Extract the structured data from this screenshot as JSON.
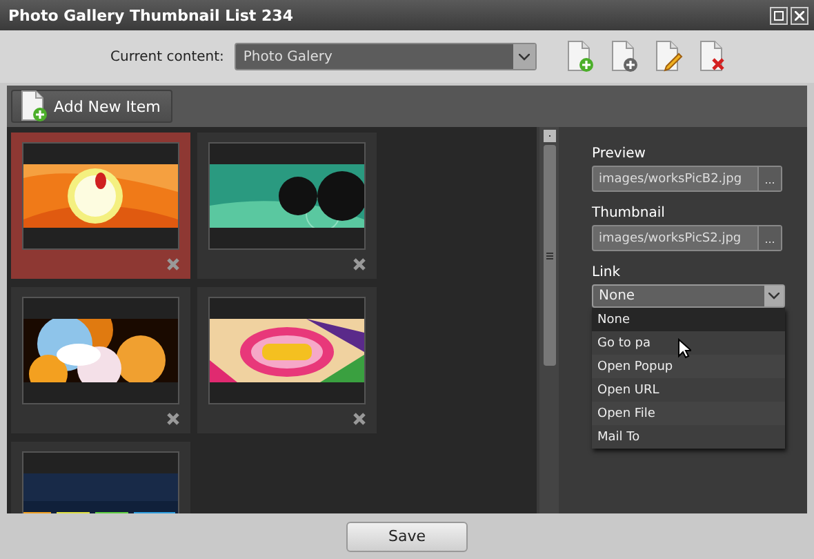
{
  "window": {
    "title": "Photo Gallery Thumbnail List 234"
  },
  "toolbar": {
    "label": "Current content:",
    "select": {
      "value": "Photo Galery"
    }
  },
  "add_button": {
    "label": "Add New Item"
  },
  "items": [
    {
      "kind": "picture",
      "selected": true
    },
    {
      "kind": "picture",
      "selected": false
    },
    {
      "kind": "picture",
      "selected": false
    },
    {
      "kind": "picture",
      "selected": false
    },
    {
      "kind": "picture",
      "selected": false
    }
  ],
  "fields": [
    {
      "label": "Preview",
      "value": "images/worksPicB2.jpg",
      "button": "..."
    },
    {
      "label": "Thumbnail",
      "value": "images/worksPicS2.jpg",
      "button": "..."
    }
  ],
  "link": {
    "label": "Link",
    "value": "None",
    "options": [
      {
        "label": "None",
        "selected": true
      },
      {
        "label": "Go to pa",
        "selected": false
      },
      {
        "label": "Open Popup",
        "selected": false
      },
      {
        "label": "Open URL",
        "selected": false
      },
      {
        "label": "Open File",
        "selected": false
      },
      {
        "label": "Mail To",
        "selected": false
      }
    ]
  },
  "save": {
    "label": "Save"
  }
}
